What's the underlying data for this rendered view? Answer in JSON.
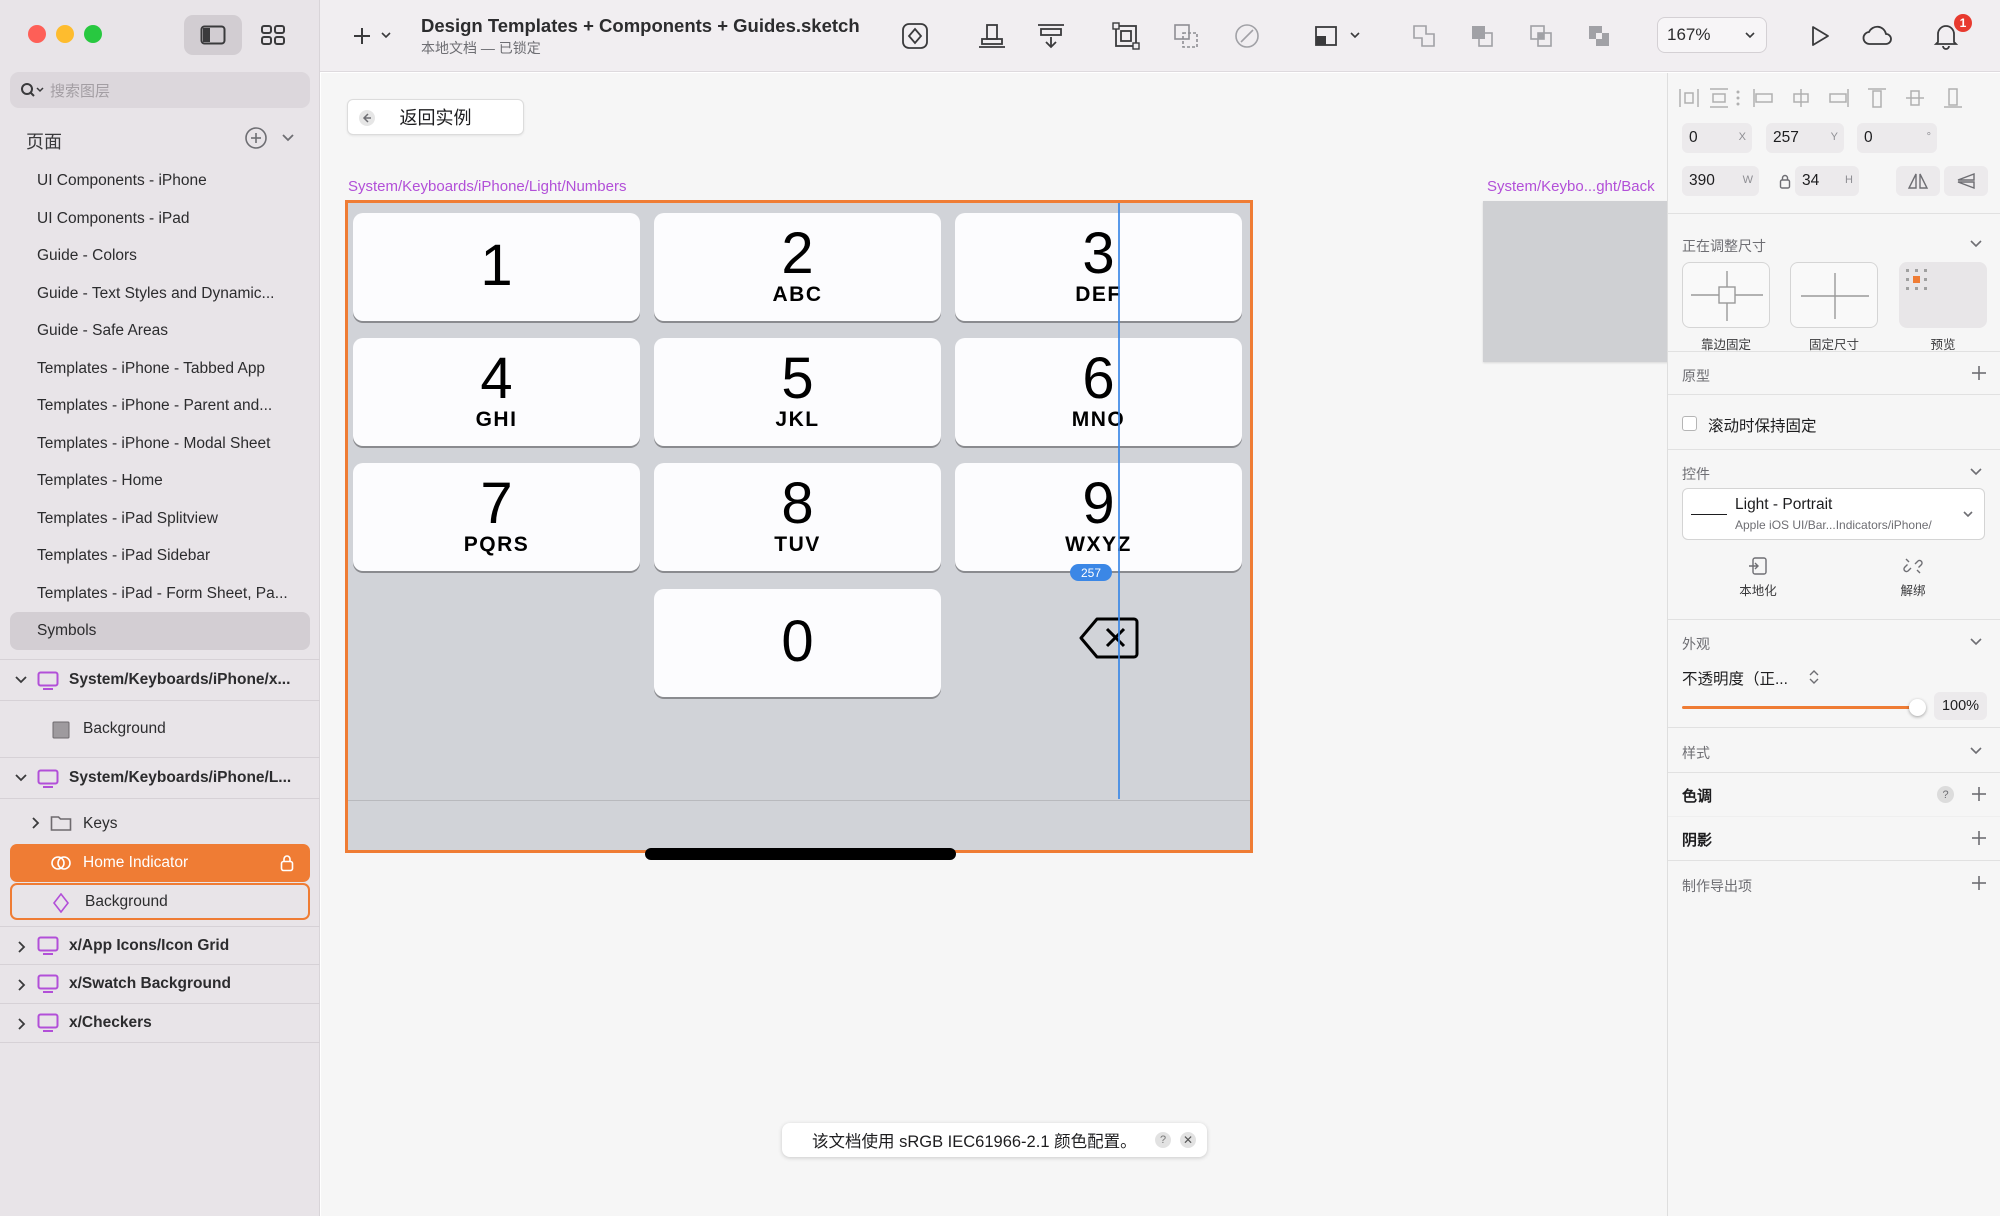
{
  "colors": {
    "accent": "#ef7c34",
    "symbol_purple": "#b24fd8",
    "guide_blue": "#3b87e6",
    "badge_red": "#e83a2f"
  },
  "sidebar": {
    "search_placeholder": "搜索图层",
    "pages_header": "页面",
    "pages": [
      "UI Components - iPhone",
      "UI Components - iPad",
      "Guide - Colors",
      "Guide - Text Styles and Dynamic...",
      "Guide - Safe Areas",
      "Templates - iPhone - Tabbed App",
      "Templates - iPhone - Parent and...",
      "Templates - iPhone - Modal Sheet",
      "Templates - Home",
      "Templates - iPad Splitview",
      "Templates - iPad Sidebar",
      "Templates - iPad - Form Sheet, Pa...",
      "Symbols"
    ],
    "selected_page": "Symbols",
    "layers": [
      {
        "label": "System/Keyboards/iPhone/x...",
        "icon": "symbol-master-icon"
      },
      {
        "label": "Background",
        "icon": "rectangle-icon"
      },
      {
        "label": "System/Keyboards/iPhone/L...",
        "icon": "symbol-master-icon"
      },
      {
        "label": "Keys",
        "icon": "folder-icon"
      },
      {
        "label": "Home Indicator",
        "icon": "symbol-instance-icon"
      },
      {
        "label": "Background",
        "icon": "symbol-instance-icon"
      },
      {
        "label": "x/App Icons/Icon Grid",
        "icon": "symbol-master-icon"
      },
      {
        "label": "x/Swatch Background",
        "icon": "symbol-master-icon"
      },
      {
        "label": "x/Checkers",
        "icon": "symbol-master-icon"
      }
    ]
  },
  "toolbar": {
    "doc_title": "Design Templates + Components + Guides.sketch",
    "doc_subtitle": "本地文档 — 已锁定",
    "zoom": "167%",
    "notification_count": "1"
  },
  "canvas": {
    "back_button": "返回实例",
    "artboard_label": "System/Keyboards/iPhone/Light/Numbers",
    "artboard_label_2": "System/Keybo...ght/Back",
    "guide_value": "257",
    "keys": [
      {
        "num": "1",
        "letters": ""
      },
      {
        "num": "2",
        "letters": "ABC"
      },
      {
        "num": "3",
        "letters": "DEF"
      },
      {
        "num": "4",
        "letters": "GHI"
      },
      {
        "num": "5",
        "letters": "JKL"
      },
      {
        "num": "6",
        "letters": "MNO"
      },
      {
        "num": "7",
        "letters": "PQRS"
      },
      {
        "num": "8",
        "letters": "TUV"
      },
      {
        "num": "9",
        "letters": "WXYZ"
      },
      {
        "num": "0",
        "letters": ""
      }
    ],
    "toast_text": "该文档使用 sRGB IEC61966-2.1 颜色配置。",
    "toast_help": "?",
    "toast_close": "✕"
  },
  "inspector": {
    "x": "0",
    "x_label": "X",
    "y": "257",
    "y_label": "Y",
    "rotation": "0",
    "rotation_label": "°",
    "w": "390",
    "w_label": "W",
    "h": "34",
    "h_label": "H",
    "resizing": {
      "title": "正在调整尺寸",
      "options": [
        "靠边固定",
        "固定尺寸",
        "预览"
      ]
    },
    "prototype": {
      "title": "原型",
      "fix_on_scroll": "滚动时保持固定"
    },
    "controls": {
      "title": "控件",
      "symbol_name": "Light - Portrait",
      "symbol_path": "Apple iOS UI/Bar...Indicators/iPhone/",
      "localize": "本地化",
      "detach": "解绑"
    },
    "appearance": {
      "title": "外观",
      "opacity_label": "不透明度（正...",
      "opacity_value": "100%",
      "opacity": 1.0
    },
    "style": {
      "title": "样式",
      "tint": "色调",
      "tint_help": "?",
      "shadow": "阴影"
    },
    "export": {
      "title": "制作导出项"
    }
  }
}
